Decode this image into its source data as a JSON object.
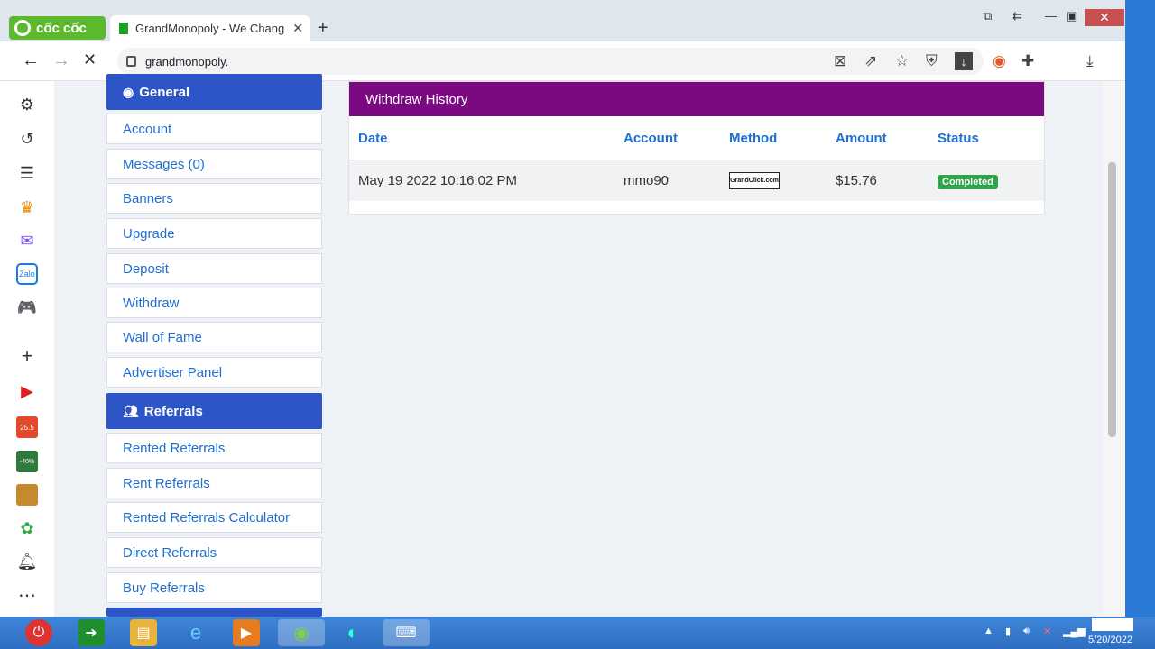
{
  "browser": {
    "brand": "cốc cốc",
    "tab_title": "GrandMonopoly - We Chang",
    "url": "grandmonopoly.",
    "new_tab": "+",
    "tab_close": "✕"
  },
  "menu": {
    "general_header": "General",
    "general_items": [
      "Account",
      "Messages (0)",
      "Banners",
      "Upgrade",
      "Deposit",
      "Withdraw",
      "Wall of Fame",
      "Advertiser Panel"
    ],
    "referrals_header": "Referrals",
    "referral_items": [
      "Rented Referrals",
      "Rent Referrals",
      "Rented Referrals Calculator",
      "Direct Referrals",
      "Buy Referrals"
    ]
  },
  "withdraw": {
    "title": "Withdraw History",
    "columns": [
      "Date",
      "Account",
      "Method",
      "Amount",
      "Status"
    ],
    "rows": [
      {
        "date": "May 19 2022 10:16:02 PM",
        "account": "mmo90",
        "method": "GrandClick.com",
        "amount": "$15.76",
        "status": "Completed"
      }
    ],
    "status_color": "#2ea54a",
    "header_color": "#7b0a82"
  },
  "taskbar": {
    "date": "5/20/2022"
  },
  "sidebar_badges": {
    "badge1": "25.5",
    "badge2": "-40%"
  }
}
